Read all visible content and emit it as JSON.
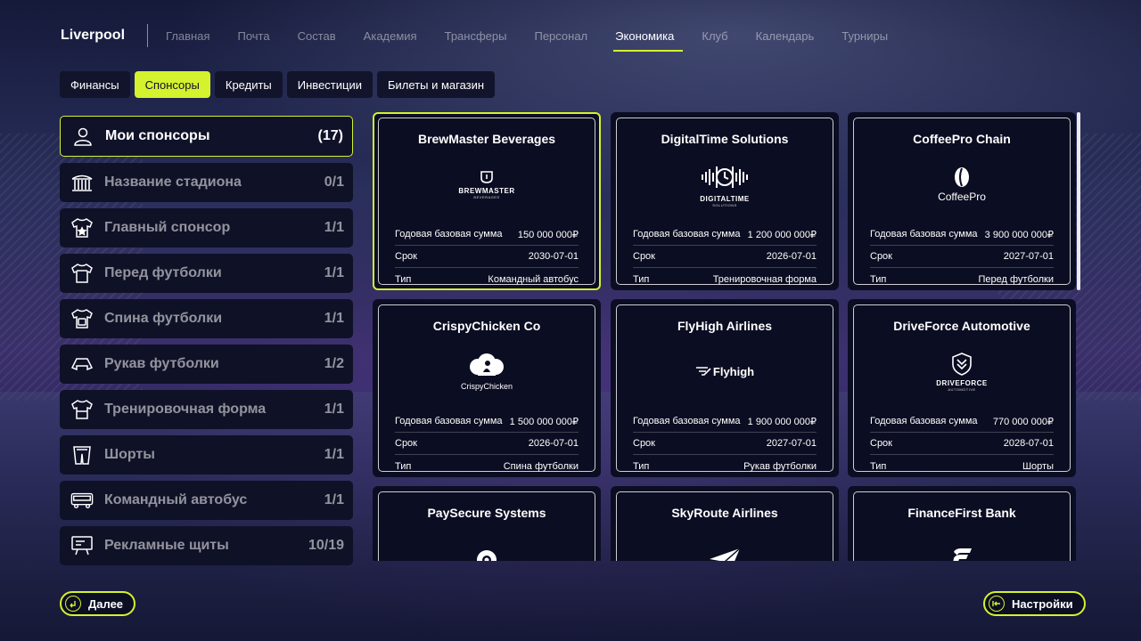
{
  "header": {
    "club": "Liverpool",
    "nav": [
      {
        "label": "Главная",
        "active": false
      },
      {
        "label": "Почта",
        "active": false
      },
      {
        "label": "Состав",
        "active": false
      },
      {
        "label": "Академия",
        "active": false
      },
      {
        "label": "Трансферы",
        "active": false
      },
      {
        "label": "Персонал",
        "active": false
      },
      {
        "label": "Экономика",
        "active": true
      },
      {
        "label": "Клуб",
        "active": false
      },
      {
        "label": "Календарь",
        "active": false
      },
      {
        "label": "Турниры",
        "active": false
      }
    ]
  },
  "subtabs": [
    {
      "label": "Финансы",
      "active": false
    },
    {
      "label": "Спонсоры",
      "active": true
    },
    {
      "label": "Кредиты",
      "active": false
    },
    {
      "label": "Инвестиции",
      "active": false
    },
    {
      "label": "Билеты и магазин",
      "active": false
    }
  ],
  "categories": [
    {
      "label": "Мои спонсоры",
      "count": "(17)",
      "icon": "user-icon",
      "active": true
    },
    {
      "label": "Название стадиона",
      "count": "0/1",
      "icon": "stadium-icon",
      "active": false
    },
    {
      "label": "Главный спонсор",
      "count": "1/1",
      "icon": "star-shirt-icon",
      "active": false
    },
    {
      "label": "Перед футболки",
      "count": "1/1",
      "icon": "shirt-front-icon",
      "active": false
    },
    {
      "label": "Спина футболки",
      "count": "1/1",
      "icon": "shirt-back-icon",
      "active": false
    },
    {
      "label": "Рукав футболки",
      "count": "1/2",
      "icon": "sleeve-icon",
      "active": false
    },
    {
      "label": "Тренировочная форма",
      "count": "1/1",
      "icon": "training-kit-icon",
      "active": false
    },
    {
      "label": "Шорты",
      "count": "1/1",
      "icon": "shorts-icon",
      "active": false
    },
    {
      "label": "Командный автобус",
      "count": "1/1",
      "icon": "bus-icon",
      "active": false
    },
    {
      "label": "Рекламные щиты",
      "count": "10/19",
      "icon": "billboard-icon",
      "active": false
    }
  ],
  "labels": {
    "amount": "Годовая базовая сумма",
    "term": "Срок",
    "type": "Тип"
  },
  "sponsors": [
    {
      "name": "BrewMaster Beverages",
      "logo": "brewmaster-logo",
      "logo_text": "BREWMASTER",
      "logo_sub": "BEVERAGES",
      "amount": "150 000 000₽",
      "term": "2030-07-01",
      "type": "Командный автобус",
      "selected": true
    },
    {
      "name": "DigitalTime Solutions",
      "logo": "digitaltime-logo",
      "logo_text": "DIGITALTIME",
      "logo_sub": "SOLUTIONS",
      "amount": "1 200 000 000₽",
      "term": "2026-07-01",
      "type": "Тренировочная форма",
      "selected": false
    },
    {
      "name": "CoffeePro Chain",
      "logo": "coffeepro-logo",
      "logo_text": "CoffeePro",
      "logo_sub": "",
      "amount": "3 900 000 000₽",
      "term": "2027-07-01",
      "type": "Перед футболки",
      "selected": false
    },
    {
      "name": "CrispyChicken Co",
      "logo": "crispychicken-logo",
      "logo_text": "CrispyChicken",
      "logo_sub": "",
      "amount": "1 500 000 000₽",
      "term": "2026-07-01",
      "type": "Спина футболки",
      "selected": false
    },
    {
      "name": "FlyHigh Airlines",
      "logo": "flyhigh-logo",
      "logo_text": "Flyhigh",
      "logo_sub": "",
      "amount": "1 900 000 000₽",
      "term": "2027-07-01",
      "type": "Рукав футболки",
      "selected": false
    },
    {
      "name": "DriveForce Automotive",
      "logo": "driveforce-logo",
      "logo_text": "DRIVEFORCE",
      "logo_sub": "AUTOMOTIVE",
      "amount": "770 000 000₽",
      "term": "2028-07-01",
      "type": "Шорты",
      "selected": false
    },
    {
      "name": "PaySecure Systems",
      "logo": "paysecure-logo",
      "logo_text": "",
      "logo_sub": "",
      "amount": "",
      "term": "",
      "type": "",
      "selected": false
    },
    {
      "name": "SkyRoute Airlines",
      "logo": "skyroute-logo",
      "logo_text": "",
      "logo_sub": "",
      "amount": "",
      "term": "",
      "type": "",
      "selected": false
    },
    {
      "name": "FinanceFirst Bank",
      "logo": "financefirst-logo",
      "logo_text": "",
      "logo_sub": "",
      "amount": "",
      "term": "",
      "type": "",
      "selected": false
    }
  ],
  "footer": {
    "next_label": "Далее",
    "settings_label": "Настройки"
  },
  "colors": {
    "accent": "#d4f22e",
    "panel": "#0f1127"
  }
}
